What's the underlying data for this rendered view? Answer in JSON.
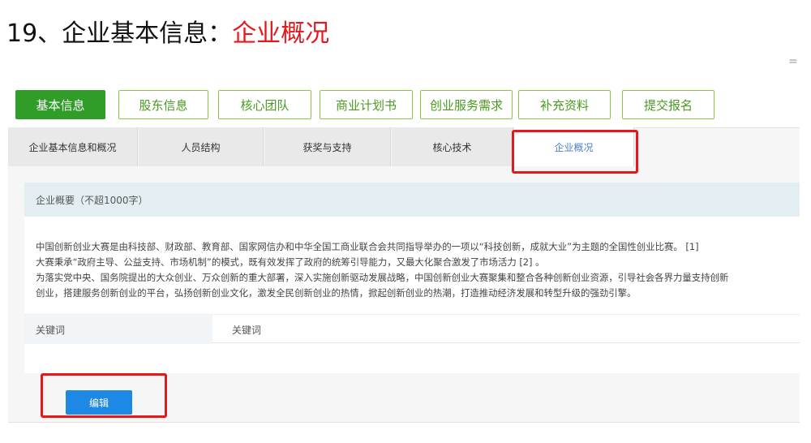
{
  "heading": {
    "prefix": "19、企业基本信息：",
    "highlight": "企业概况"
  },
  "misc": {
    "eq_mark": "="
  },
  "top_nav": {
    "items": [
      {
        "label": "基本信息",
        "active": true
      },
      {
        "label": "股东信息"
      },
      {
        "label": "核心团队"
      },
      {
        "label": "商业计划书"
      },
      {
        "label": "创业服务需求"
      },
      {
        "label": "补充资料"
      },
      {
        "label": "提交报名"
      }
    ]
  },
  "sub_tabs": {
    "items": [
      {
        "label": "企业基本信息和概况"
      },
      {
        "label": "人员结构"
      },
      {
        "label": "获奖与支持"
      },
      {
        "label": "核心技术"
      },
      {
        "label": "企业概况",
        "active": true
      }
    ]
  },
  "overview": {
    "section_label": "企业概要（不超1000字）",
    "lines": [
      "中国创新创业大赛是由科技部、财政部、教育部、国家网信办和中华全国工商业联合会共同指导举办的一项以“科技创新，成就大业”为主题的全国性创业比赛。 [1]",
      "大赛秉承“政府主导、公益支持、市场机制”的模式，既有效发挥了政府的统筹引导能力，又最大化聚合激发了市场活力 [2] 。",
      "为落实党中央、国务院提出的大众创业、万众创新的重大部署，深入实施创新驱动发展战略，中国创新创业大赛聚集和整合各种创新创业资源，引导社会各界力量支持创新",
      "创业，搭建服务创新创业的平台，弘扬创新创业文化，激发全民创新创业的热情，掀起创新创业的热潮，打造推动经济发展和转型升级的强劲引擎。"
    ]
  },
  "keywords": {
    "label": "关键词",
    "value": "关键词"
  },
  "actions": {
    "edit_label": "编辑"
  },
  "colors": {
    "accent_green": "#2f9d27",
    "highlight_red": "#e5191b",
    "edit_blue": "#1e88e5",
    "active_tab_text": "#4a7fc0"
  }
}
